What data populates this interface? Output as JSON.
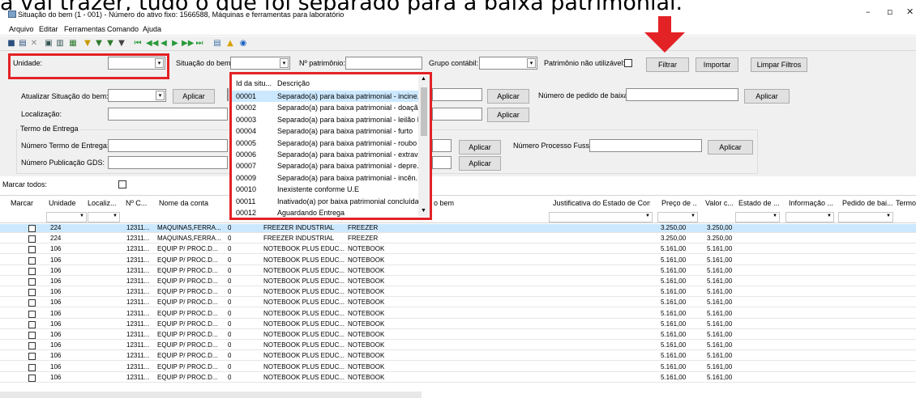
{
  "caption": "a vai trazer, tudo o que foi separado para a baixa patrimonial.",
  "window": {
    "title": "Situação do bem (1 - 001) - Número do ativo fixo: 1566588, Máquinas e ferramentas para laboratório",
    "minimize": "–",
    "maximize": "▫",
    "close": "✕"
  },
  "menu": [
    "Arquivo",
    "Editar",
    "Ferramentas",
    "Comando",
    "Ajuda"
  ],
  "toolbar_icons": [
    "save-icon",
    "save-as-icon",
    "delete-icon",
    "print-icon",
    "print-preview-icon",
    "export-icon",
    "filter-icon",
    "filter-edit-icon",
    "filter-add-icon",
    "filter-clear-icon",
    "first-icon",
    "prev-page-icon",
    "prev-icon",
    "next-icon",
    "next-page-icon",
    "last-icon",
    "document-icon",
    "warning-icon",
    "help-icon"
  ],
  "filters": {
    "unidade_label": "Unidade:",
    "situacao_label": "Situação do bem:",
    "patrimonio_label": "Nº patrimônio:",
    "grupo_label": "Grupo contábil:",
    "nao_utilizavel_label": "Patrimônio não utilizável:",
    "filtrar": "Filtrar",
    "importar": "Importar",
    "limpar": "Limpar Filtros",
    "atualizar_label": "Atualizar Situação do bem:",
    "aplicar": "Aplicar",
    "pedido_baixa_label": "Número de pedido de baixa:",
    "localizacao_label": "Localização:",
    "termo_group": "Termo de Entrega",
    "termo_numero_label": "Número Termo de Entrega:",
    "processo_label": "Número Processo Fussp:",
    "publicacao_label": "Número Publicação GDS:",
    "marcar_todos": "Marcar todos:"
  },
  "dropdown": {
    "col_id": "Id da situ...",
    "col_desc": "Descrição",
    "items": [
      {
        "id": "00001",
        "desc": "Separado(a) para baixa patrimonial - incine..."
      },
      {
        "id": "00002",
        "desc": "Separado(a) para baixa patrimonial - doação"
      },
      {
        "id": "00003",
        "desc": "Separado(a) para baixa patrimonial - leilão I"
      },
      {
        "id": "00004",
        "desc": "Separado(a) para baixa patrimonial - furto"
      },
      {
        "id": "00005",
        "desc": "Separado(a) para baixa patrimonial - roubo"
      },
      {
        "id": "00006",
        "desc": "Separado(a) para baixa patrimonial - extrav..."
      },
      {
        "id": "00007",
        "desc": "Separado(a) para baixa patrimonial - depre..."
      },
      {
        "id": "00009",
        "desc": "Separado(a) para baixa patrimonial - incên..."
      },
      {
        "id": "00010",
        "desc": "Inexistente conforme U.E"
      },
      {
        "id": "00011",
        "desc": "Inativado(a) por baixa patrimonial concluída"
      },
      {
        "id": "00012",
        "desc": "Aguardando Entrega"
      }
    ]
  },
  "grid": {
    "headers": [
      "Marcar",
      "Unidade",
      "Localiz...",
      "Nº C...",
      "Nome da conta",
      "",
      "",
      "o bem",
      "Justificativa do Estado de Con...",
      "Preço de ...",
      "Valor c...",
      "Estado de ...",
      "Informação ...",
      "Pedido de bai...",
      "Termo"
    ],
    "rows": [
      {
        "unidade": "224",
        "nc": "12311...",
        "conta": "MAQUINAS,FERRA...",
        "zero": "0",
        "nome": "FREEZER INDUSTRIAL",
        "tipo": "FREEZER",
        "preco": "3.250,00",
        "valor": "3.250,00"
      },
      {
        "unidade": "224",
        "nc": "12311...",
        "conta": "MAQUINAS,FERRA...",
        "zero": "0",
        "nome": "FREEZER INDUSTRIAL",
        "tipo": "FREEZER",
        "preco": "3.250,00",
        "valor": "3.250,00"
      },
      {
        "unidade": "106",
        "nc": "12311...",
        "conta": "EQUIP P/ PROC.D...",
        "zero": "0",
        "nome": "NOTEBOOK PLUS EDUC...",
        "tipo": "NOTEBOOK",
        "preco": "5.161,00",
        "valor": "5.161,00"
      },
      {
        "unidade": "106",
        "nc": "12311...",
        "conta": "EQUIP P/ PROC.D...",
        "zero": "0",
        "nome": "NOTEBOOK PLUS EDUC...",
        "tipo": "NOTEBOOK",
        "preco": "5.161,00",
        "valor": "5.161,00"
      },
      {
        "unidade": "106",
        "nc": "12311...",
        "conta": "EQUIP P/ PROC.D...",
        "zero": "0",
        "nome": "NOTEBOOK PLUS EDUC...",
        "tipo": "NOTEBOOK",
        "preco": "5.161,00",
        "valor": "5.161,00"
      },
      {
        "unidade": "106",
        "nc": "12311...",
        "conta": "EQUIP P/ PROC.D...",
        "zero": "0",
        "nome": "NOTEBOOK PLUS EDUC...",
        "tipo": "NOTEBOOK",
        "preco": "5.161,00",
        "valor": "5.161,00"
      },
      {
        "unidade": "106",
        "nc": "12311...",
        "conta": "EQUIP P/ PROC.D...",
        "zero": "0",
        "nome": "NOTEBOOK PLUS EDUC...",
        "tipo": "NOTEBOOK",
        "preco": "5.161,00",
        "valor": "5.161,00"
      },
      {
        "unidade": "106",
        "nc": "12311...",
        "conta": "EQUIP P/ PROC.D...",
        "zero": "0",
        "nome": "NOTEBOOK PLUS EDUC...",
        "tipo": "NOTEBOOK",
        "preco": "5.161,00",
        "valor": "5.161,00"
      },
      {
        "unidade": "106",
        "nc": "12311...",
        "conta": "EQUIP P/ PROC.D...",
        "zero": "0",
        "nome": "NOTEBOOK PLUS EDUC...",
        "tipo": "NOTEBOOK",
        "preco": "5.161,00",
        "valor": "5.161,00"
      },
      {
        "unidade": "106",
        "nc": "12311...",
        "conta": "EQUIP P/ PROC.D...",
        "zero": "0",
        "nome": "NOTEBOOK PLUS EDUC...",
        "tipo": "NOTEBOOK",
        "preco": "5.161,00",
        "valor": "5.161,00"
      },
      {
        "unidade": "106",
        "nc": "12311...",
        "conta": "EQUIP P/ PROC.D...",
        "zero": "0",
        "nome": "NOTEBOOK PLUS EDUC...",
        "tipo": "NOTEBOOK",
        "preco": "5.161,00",
        "valor": "5.161,00"
      },
      {
        "unidade": "106",
        "nc": "12311...",
        "conta": "EQUIP P/ PROC.D...",
        "zero": "0",
        "nome": "NOTEBOOK PLUS EDUC...",
        "tipo": "NOTEBOOK",
        "preco": "5.161,00",
        "valor": "5.161,00"
      },
      {
        "unidade": "106",
        "nc": "12311...",
        "conta": "EQUIP P/ PROC.D...",
        "zero": "0",
        "nome": "NOTEBOOK PLUS EDUC...",
        "tipo": "NOTEBOOK",
        "preco": "5.161,00",
        "valor": "5.161,00"
      },
      {
        "unidade": "106",
        "nc": "12311...",
        "conta": "EQUIP P/ PROC.D...",
        "zero": "0",
        "nome": "NOTEBOOK PLUS EDUC...",
        "tipo": "NOTEBOOK",
        "preco": "5.161,00",
        "valor": "5.161,00"
      },
      {
        "unidade": "106",
        "nc": "12311...",
        "conta": "EQUIP P/ PROC.D...",
        "zero": "0",
        "nome": "NOTEBOOK PLUS EDUC...",
        "tipo": "NOTEBOOK",
        "preco": "5.161,00",
        "valor": "5.161,00"
      }
    ]
  },
  "colors": {
    "highlight": "#e32226",
    "selection": "#cce8ff",
    "panel": "#f0f0f0"
  }
}
